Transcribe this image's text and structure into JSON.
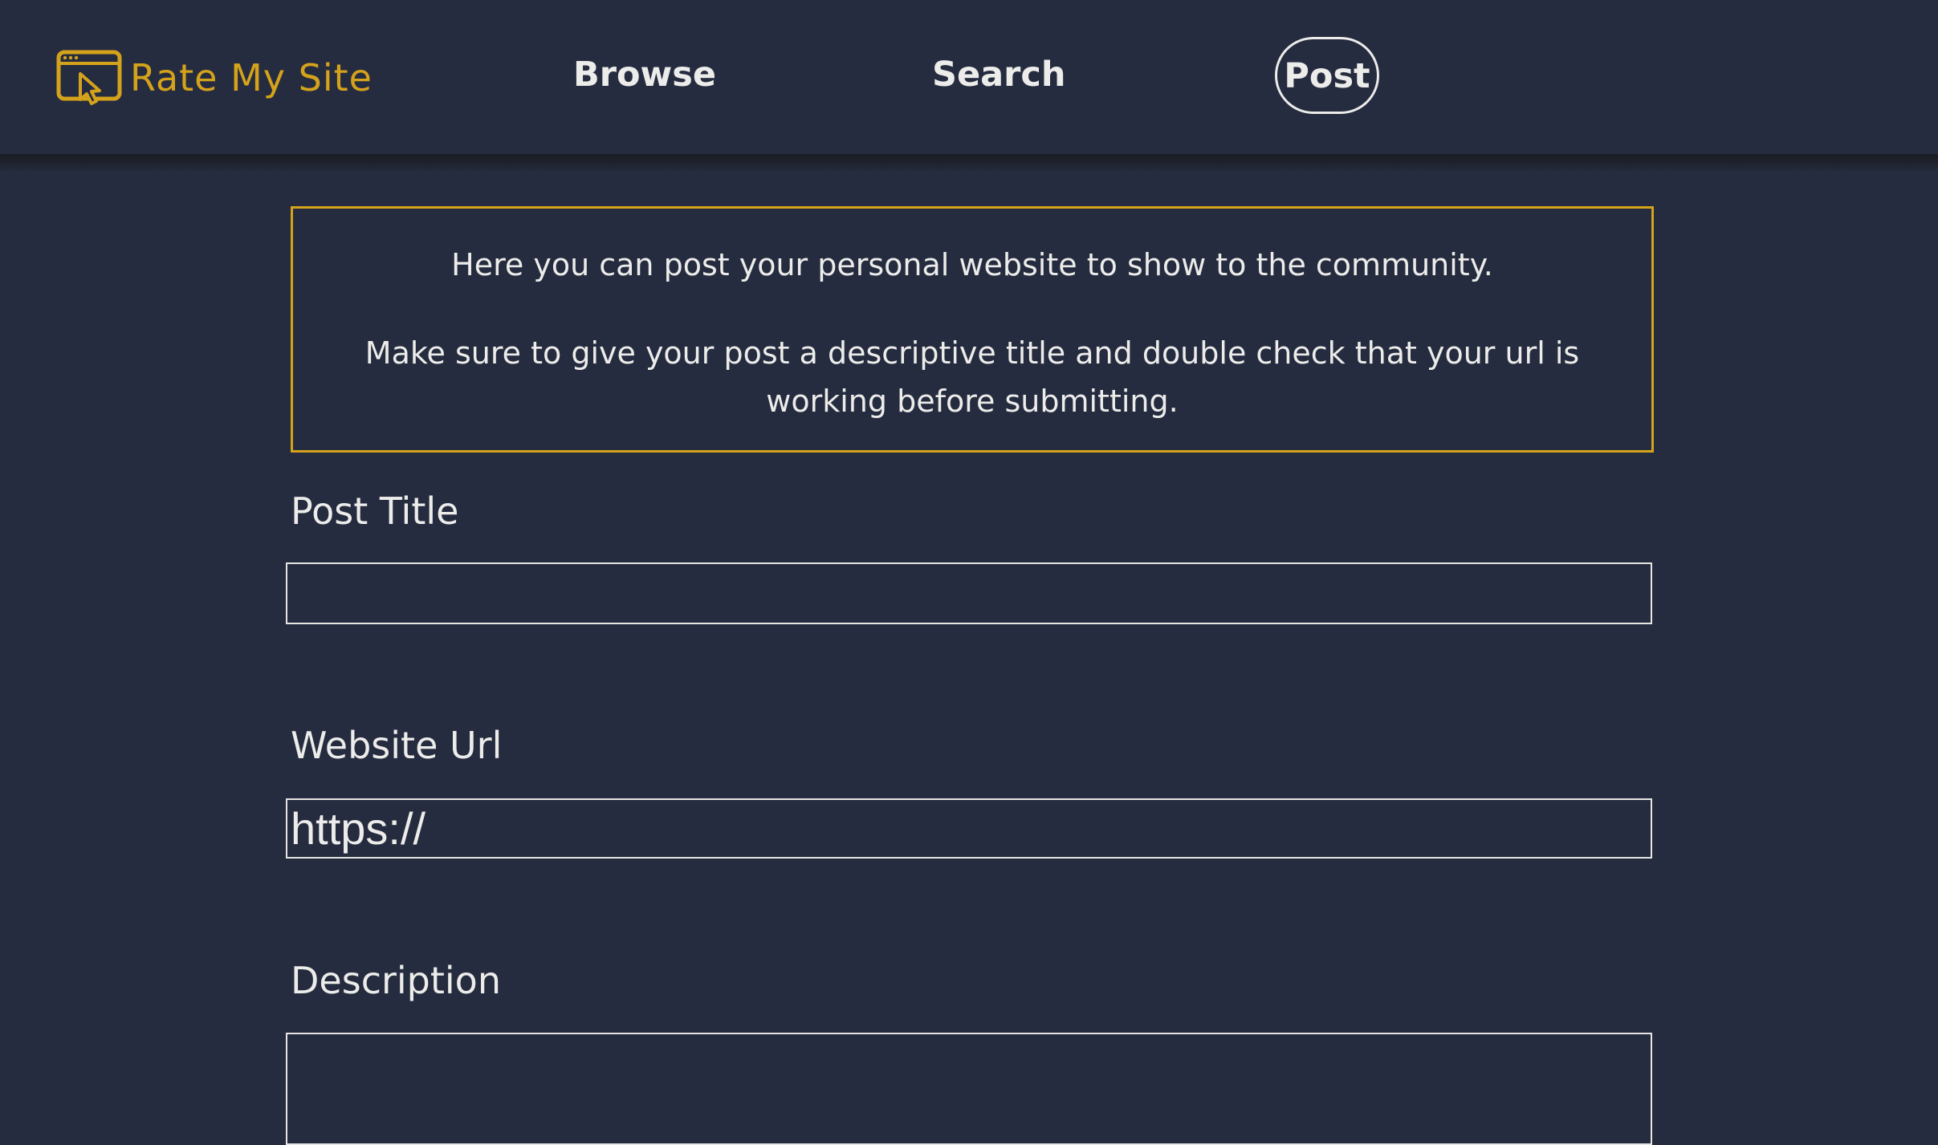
{
  "brand": {
    "name": "Rate My Site",
    "icon": "browser-cursor-icon",
    "color": "#d4a21b"
  },
  "nav": {
    "browse": "Browse",
    "search": "Search",
    "post": "Post"
  },
  "info": {
    "line1": "Here you can post your personal website to show to the community.",
    "line2": "Make sure to give your post a descriptive title and double check that your url is working before submitting."
  },
  "form": {
    "title_label": "Post Title",
    "title_value": "",
    "url_label": "Website Url",
    "url_value": "https://",
    "description_label": "Description",
    "description_value": ""
  },
  "colors": {
    "background": "#262c3f",
    "accent": "#d4a21b",
    "text": "#ececea"
  }
}
